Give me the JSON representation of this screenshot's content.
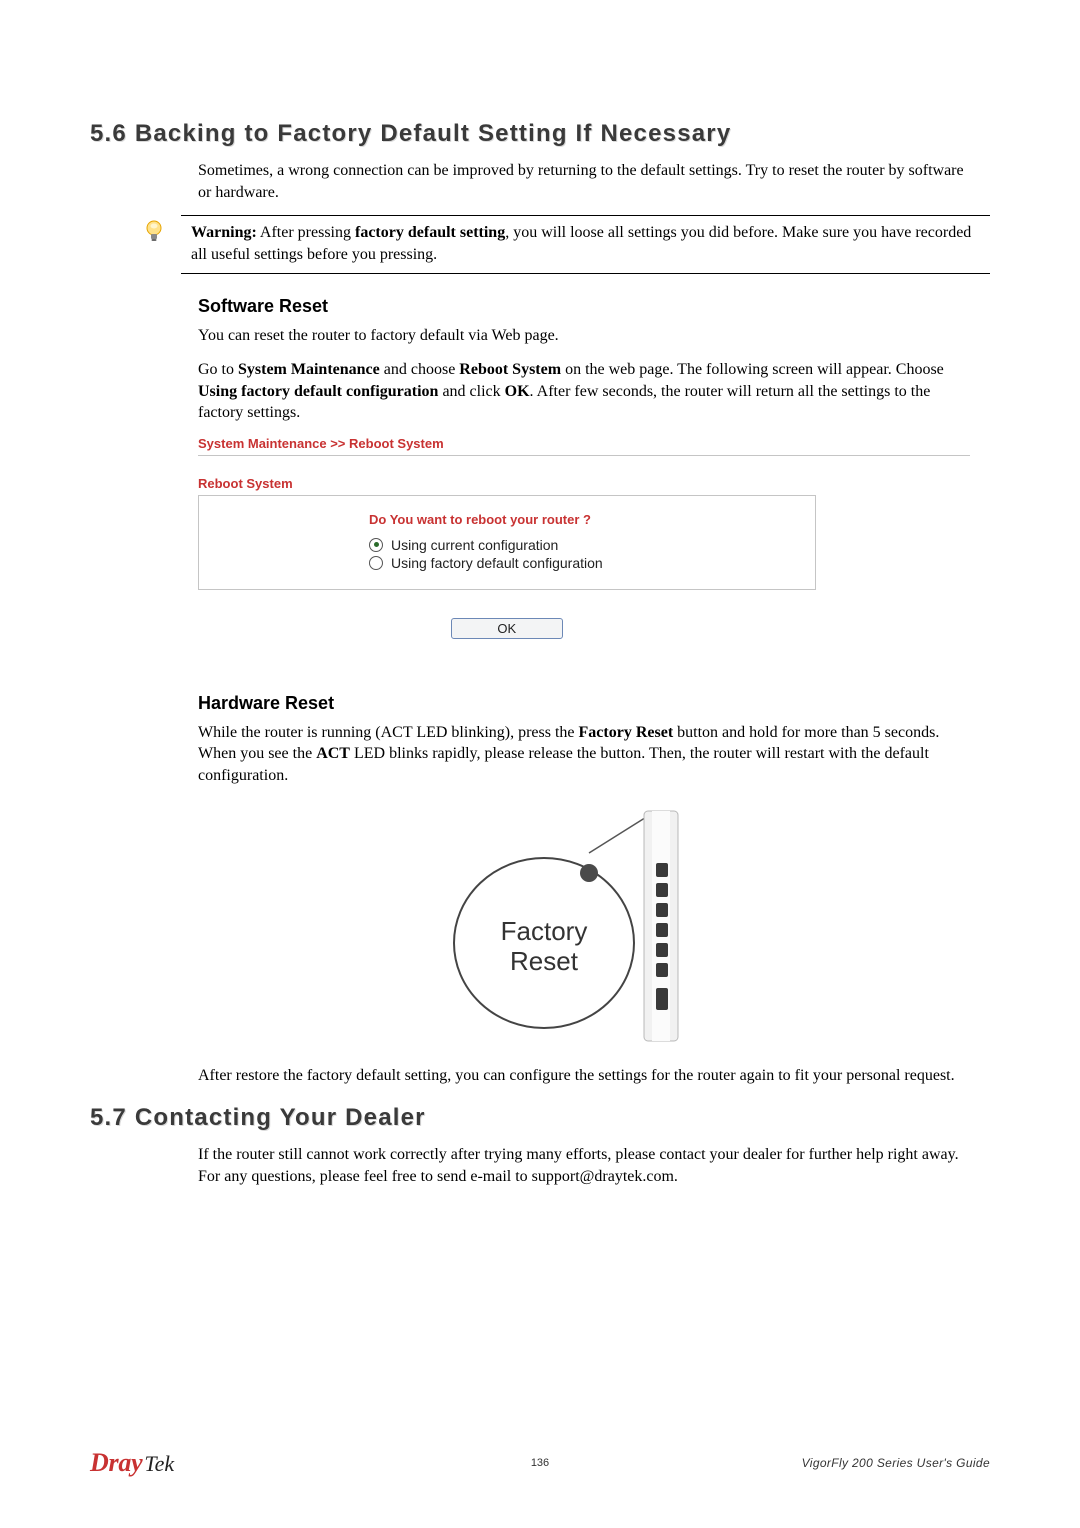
{
  "section_5_6": {
    "title": "5.6 Backing to Factory Default Setting If Necessary",
    "intro": "Sometimes, a wrong connection can be improved by returning to the default settings. Try to reset the router by software or hardware.",
    "warning_label": "Warning:",
    "warning_bold1": "factory default setting",
    "warning_before1": " After pressing ",
    "warning_after1": ", you will loose all settings you did before. Make sure you have recorded all useful settings before you pressing.",
    "software_reset": {
      "heading": "Software Reset",
      "p1": "You can reset the router to factory default via Web page.",
      "p2_a": "Go to ",
      "p2_b_bold": "System Maintenance",
      "p2_c": " and choose ",
      "p2_d_bold": "Reboot System",
      "p2_e": " on the web page. The following screen will appear. Choose ",
      "p2_f_bold": "Using factory default configuration",
      "p2_g": " and click ",
      "p2_h_bold": "OK",
      "p2_i": ". After few seconds, the router will return all the settings to the factory settings."
    },
    "screenshot": {
      "breadcrumb": "System Maintenance >> Reboot System",
      "panel_title": "Reboot System",
      "question": "Do You want to reboot your router ?",
      "opt1": "Using current configuration",
      "opt2": "Using factory default configuration",
      "ok": "OK"
    },
    "hardware_reset": {
      "heading": "Hardware Reset",
      "p1_a": "While the router is running (ACT LED blinking), press the ",
      "p1_b_bold": "Factory Reset",
      "p1_c": " button and hold for more than 5 seconds. When you see the ",
      "p1_d_bold": "ACT",
      "p1_e": " LED blinks rapidly, please release the button. Then, the router will restart with the default configuration.",
      "figure_label": "Factory Reset",
      "p2": "After restore the factory default setting, you can configure the settings for the router again to fit your personal request."
    }
  },
  "section_5_7": {
    "title": "5.7 Contacting Your Dealer",
    "p1": "If the router still cannot work correctly after trying many efforts, please contact your dealer for further help right away. For any questions, please feel free to send e-mail to support@draytek.com."
  },
  "footer": {
    "logo_a": "Dray",
    "logo_b": "Tek",
    "page": "136",
    "guide": "VigorFly 200 Series User's Guide"
  }
}
